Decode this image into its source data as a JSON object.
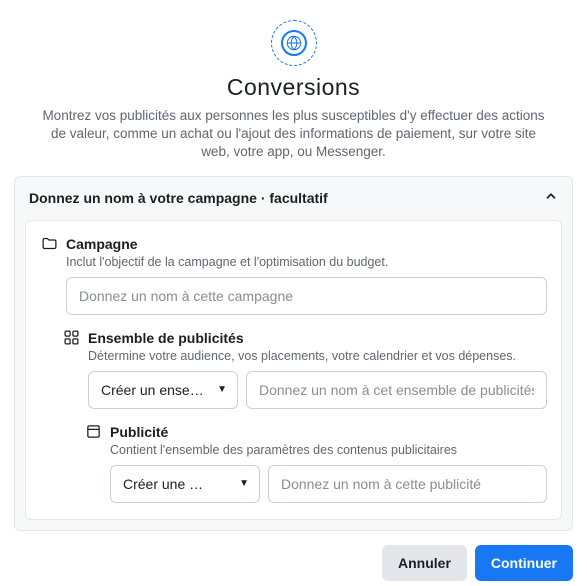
{
  "hero": {
    "title": "Conversions",
    "description": "Montrez vos publicités aux personnes les plus susceptibles d'y effectuer des actions de valeur, comme un achat ou l'ajout des informations de paiement, sur votre site web, votre app, ou Messenger."
  },
  "panel": {
    "header": "Donnez un nom à votre campagne · facultatif"
  },
  "levels": {
    "campaign": {
      "label": "Campagne",
      "desc": "Inclut l'objectif de la campagne et l'optimisation du budget.",
      "placeholder": "Donnez un nom à cette campagne"
    },
    "adset": {
      "label": "Ensemble de publicités",
      "desc": "Détermine votre audience, vos placements, votre calendrier et vos dépenses.",
      "select": "Créer un ense…",
      "placeholder": "Donnez un nom à cet ensemble de publicités"
    },
    "ad": {
      "label": "Publicité",
      "desc": "Contient l'ensemble des paramètres des contenus publicitaires",
      "select": "Créer une …",
      "placeholder": "Donnez un nom à cette publicité"
    }
  },
  "footer": {
    "cancel": "Annuler",
    "continue": "Continuer"
  }
}
